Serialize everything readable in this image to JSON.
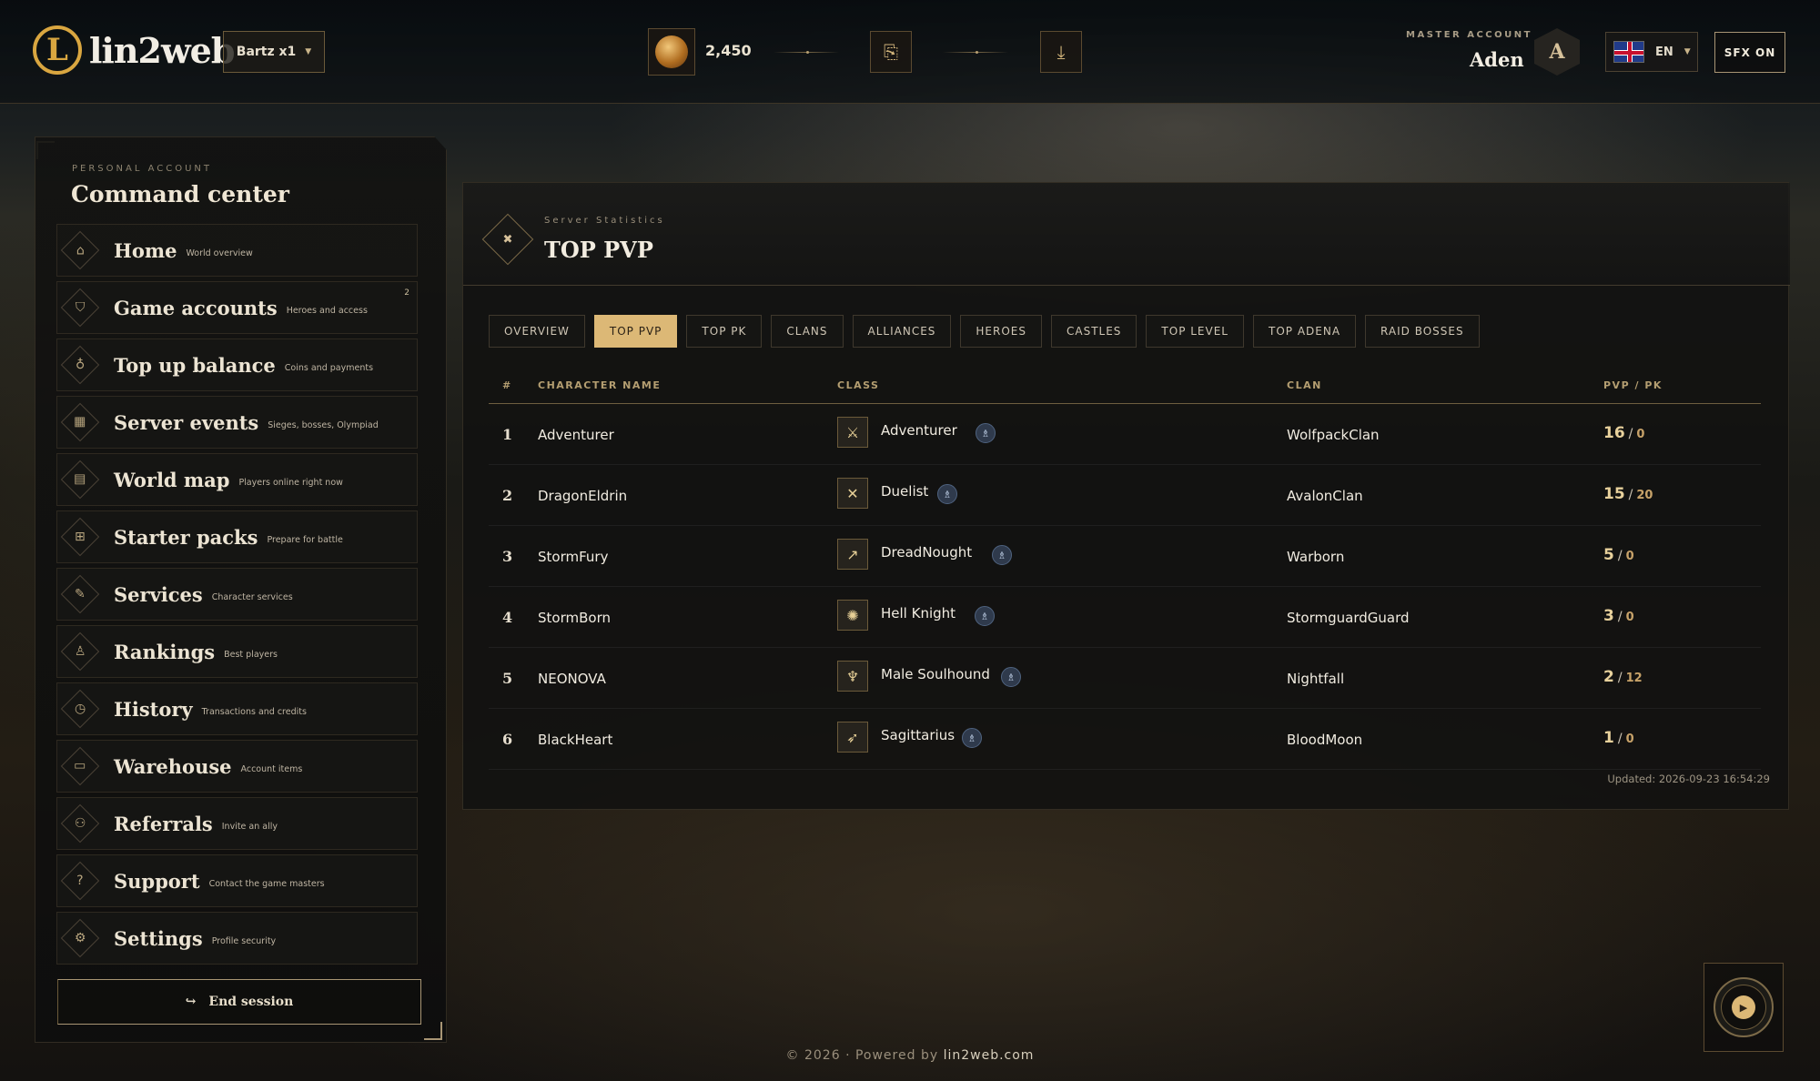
{
  "header": {
    "logo_mark": "L",
    "logo_text": "lin2web",
    "server": "Bartz x1",
    "coins": "2,450",
    "icons": [
      "coin-icon",
      "ticket-icon",
      "download-icon"
    ],
    "master_label": "MASTER ACCOUNT",
    "master_name": "Aden",
    "avatar_letter": "A",
    "language": "EN",
    "sfx": "SFX ON"
  },
  "sidebar": {
    "label": "PERSONAL ACCOUNT",
    "title": "Command center",
    "items": [
      {
        "label": "Home",
        "sub": "World overview",
        "icon": "⌂",
        "icon_name": "home-icon"
      },
      {
        "label": "Game accounts",
        "sub": "Heroes and access",
        "icon": "⛉",
        "icon_name": "shield-icon",
        "badge": "2"
      },
      {
        "label": "Top up balance",
        "sub": "Coins and payments",
        "icon": "♁",
        "icon_name": "coin-bag-icon"
      },
      {
        "label": "Server events",
        "sub": "Sieges, bosses, Olympiad",
        "icon": "▦",
        "icon_name": "calendar-icon"
      },
      {
        "label": "World map",
        "sub": "Players online right now",
        "icon": "▤",
        "icon_name": "map-icon"
      },
      {
        "label": "Starter packs",
        "sub": "Prepare for battle",
        "icon": "⊞",
        "icon_name": "gift-icon"
      },
      {
        "label": "Services",
        "sub": "Character services",
        "icon": "✎",
        "icon_name": "wrench-icon"
      },
      {
        "label": "Rankings",
        "sub": "Best players",
        "icon": "♙",
        "icon_name": "medal-icon"
      },
      {
        "label": "History",
        "sub": "Transactions and credits",
        "icon": "◷",
        "icon_name": "clock-icon"
      },
      {
        "label": "Warehouse",
        "sub": "Account items",
        "icon": "▭",
        "icon_name": "box-icon"
      },
      {
        "label": "Referrals",
        "sub": "Invite an ally",
        "icon": "⚇",
        "icon_name": "users-icon"
      },
      {
        "label": "Support",
        "sub": "Contact the game masters",
        "icon": "?",
        "icon_name": "help-icon"
      },
      {
        "label": "Settings",
        "sub": "Profile security",
        "icon": "⚙",
        "icon_name": "gear-icon"
      }
    ],
    "end_session": "End session"
  },
  "panel": {
    "label": "Server Statistics",
    "title": "TOP PVP",
    "tabs": [
      "OVERVIEW",
      "TOP PVP",
      "TOP PK",
      "CLANS",
      "ALLIANCES",
      "HEROES",
      "CASTLES",
      "TOP LEVEL",
      "TOP ADENA",
      "RAID BOSSES"
    ],
    "active_tab": "TOP PVP",
    "columns": [
      "#",
      "CHARACTER NAME",
      "CLASS",
      "CLAN",
      "PVP / PK"
    ],
    "rows": [
      {
        "rank": "1",
        "name": "Adventurer",
        "class": "Adventurer",
        "class_icon": "⚔",
        "clan": "WolfpackClan",
        "pvp": "16",
        "pk": "0"
      },
      {
        "rank": "2",
        "name": "DragonEldrin",
        "class": "Duelist",
        "class_icon": "✕",
        "clan": "AvalonClan",
        "pvp": "15",
        "pk": "20"
      },
      {
        "rank": "3",
        "name": "StormFury",
        "class": "DreadNought",
        "class_icon": "↗",
        "clan": "Warborn",
        "pvp": "5",
        "pk": "0"
      },
      {
        "rank": "4",
        "name": "StormBorn",
        "class": "Hell Knight",
        "class_icon": "✺",
        "clan": "StormguardGuard",
        "pvp": "3",
        "pk": "0"
      },
      {
        "rank": "5",
        "name": "NEONOVA",
        "class": "Male Soulhound",
        "class_icon": "♆",
        "clan": "Nightfall",
        "pvp": "2",
        "pk": "12"
      },
      {
        "rank": "6",
        "name": "BlackHeart",
        "class": "Sagittarius",
        "class_icon": "➶",
        "clan": "BloodMoon",
        "pvp": "1",
        "pk": "0"
      }
    ],
    "updated": "Updated: 2026-09-23 16:54:29"
  },
  "footer": {
    "prefix": "© 2026 · Powered by",
    "link": "lin2web.com"
  },
  "colors": {
    "accent": "#dcb876",
    "background": "#1a1a16"
  }
}
